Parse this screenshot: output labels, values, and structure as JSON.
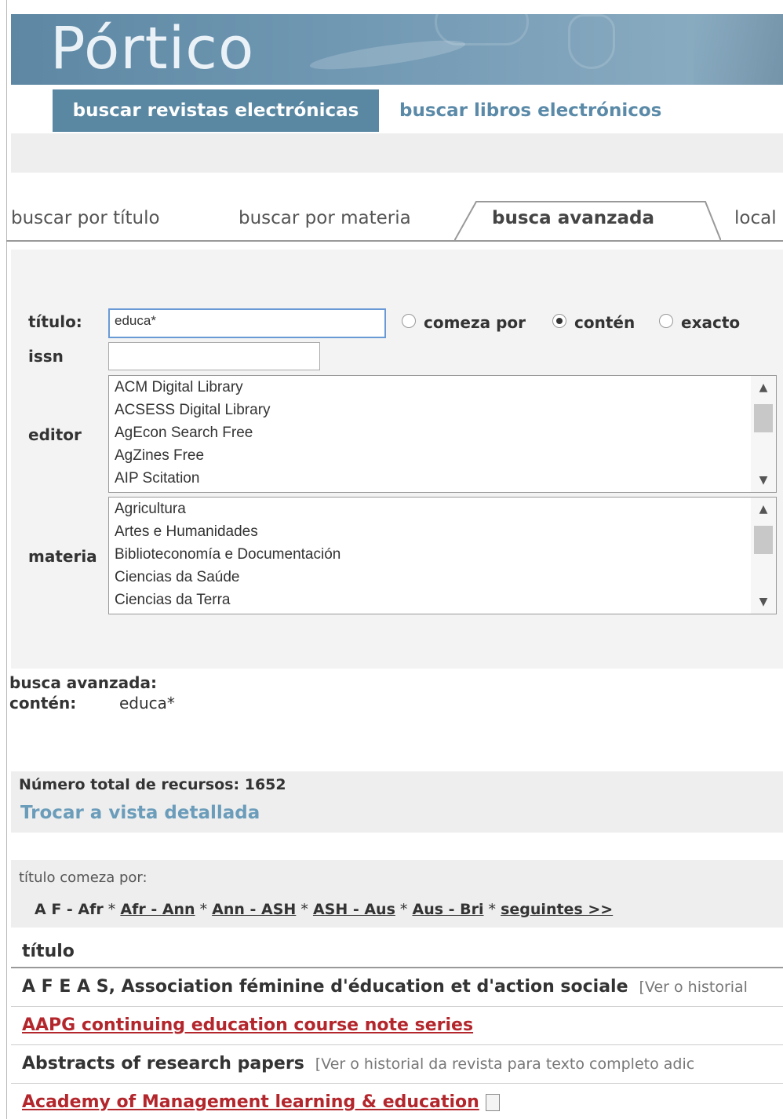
{
  "logo": "Pórtico",
  "topnav": {
    "active": "buscar revistas electrónicas",
    "other": "buscar libros electrónicos"
  },
  "search_tabs": [
    "buscar por título",
    "buscar por materia",
    "busca avanzada",
    "local"
  ],
  "form": {
    "titulo_label": "título:",
    "titulo_value": "educa*",
    "issn_label": "issn",
    "issn_value": "",
    "radios": [
      {
        "label": "comeza por",
        "selected": false
      },
      {
        "label": "contén",
        "selected": true
      },
      {
        "label": "exacto",
        "selected": false
      }
    ],
    "editor_label": "editor",
    "editor_options": [
      "ACM Digital Library",
      "ACSESS Digital Library",
      "AgEcon Search Free",
      "AgZines Free",
      "AIP Scitation"
    ],
    "materia_label": "materia",
    "materia_options": [
      "Agricultura",
      "Artes e Humanidades",
      "Biblioteconomía e Documentación",
      "Ciencias da Saúde",
      "Ciencias da Terra"
    ]
  },
  "summary": {
    "heading": "busca avanzada:",
    "key": "contén:",
    "value": "educa*"
  },
  "total": {
    "text": "Número total de recursos: 1652",
    "toggle": "Trocar a vista detallada"
  },
  "alpha": {
    "label": "título comeza por:",
    "current": "A F - Afr",
    "ranges": [
      "Afr - Ann",
      "Ann - ASH",
      "ASH - Aus",
      "Aus - Bri",
      "seguintes >>"
    ]
  },
  "results": {
    "header": "título",
    "rows": [
      {
        "title": "A F E A S, Association féminine d'éducation et d'action sociale",
        "link": false,
        "extra": "[Ver o historial"
      },
      {
        "title": "AAPG continuing education course note series",
        "link": true,
        "extra": ""
      },
      {
        "title": "Abstracts of research papers",
        "link": false,
        "extra": "[Ver o historial da revista para texto completo adic"
      },
      {
        "title": "Academy of Management learning & education",
        "link": true,
        "extra": "",
        "icon": "document-icon"
      }
    ]
  },
  "colors": {
    "banner": "#6a93ad",
    "nav_active": "#5a88a3",
    "link_red": "#b3262c",
    "link_blue": "#6b9dbb"
  }
}
